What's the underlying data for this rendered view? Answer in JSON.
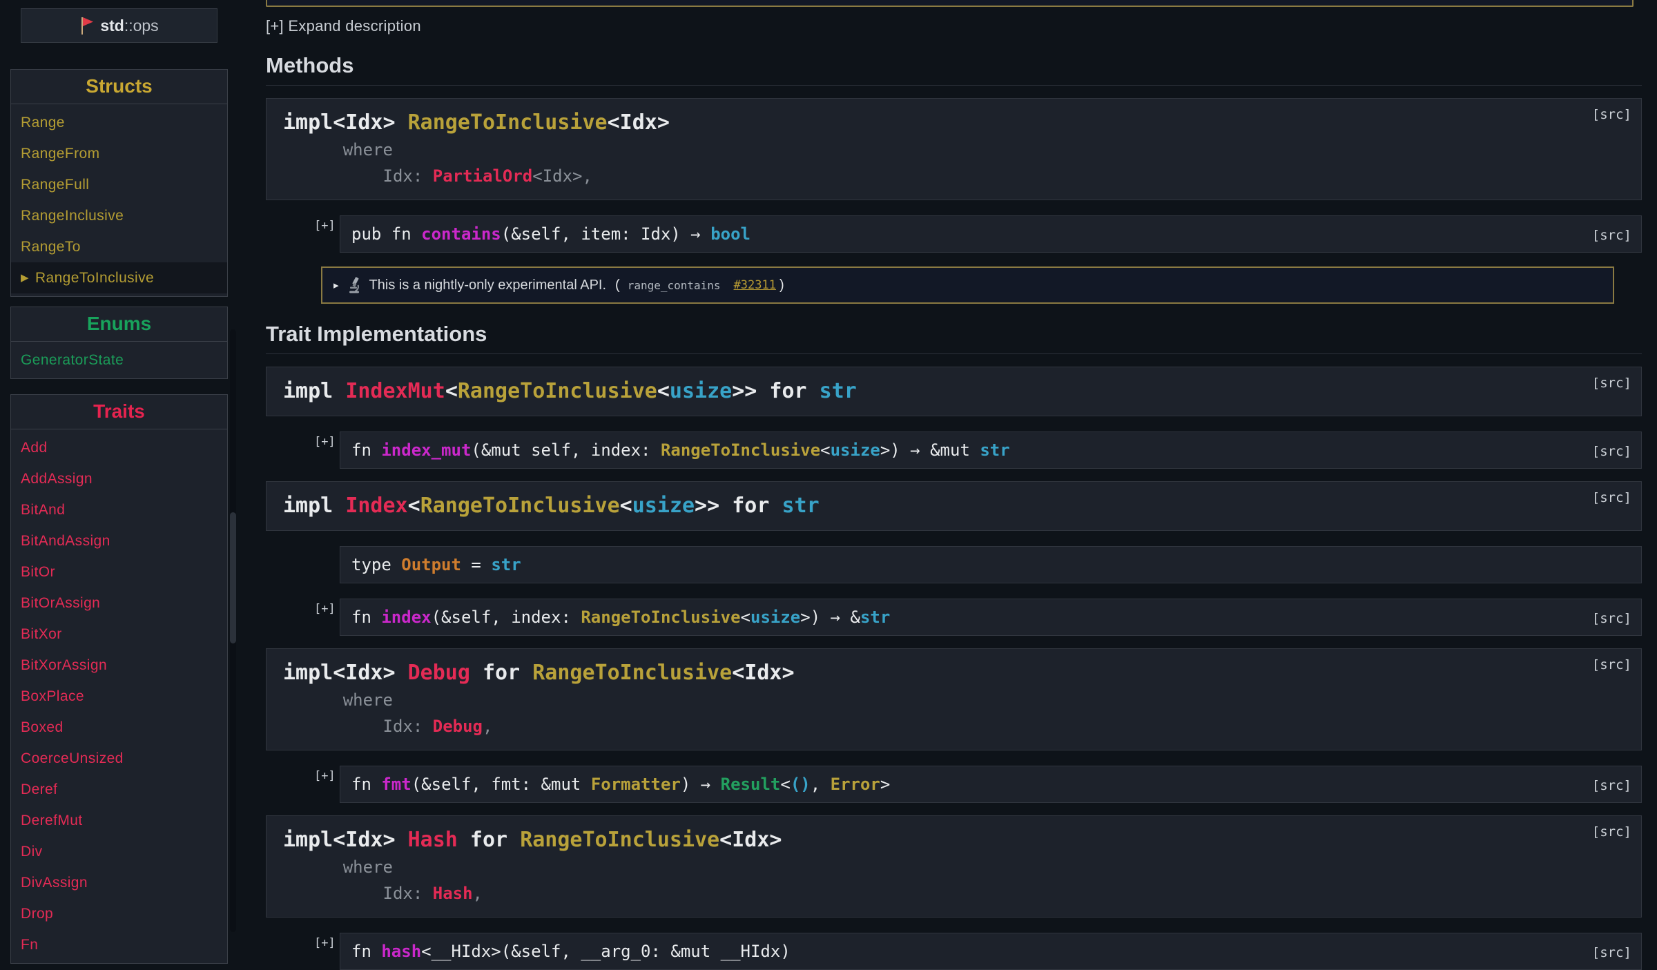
{
  "crumb": {
    "module": "std",
    "rest": "::ops"
  },
  "sidebar": {
    "sections": [
      {
        "title": "Structs",
        "kind": "struct",
        "items": [
          "Range",
          "RangeFrom",
          "RangeFull",
          "RangeInclusive",
          "RangeTo",
          "RangeToInclusive"
        ],
        "selected_index": 5
      },
      {
        "title": "Enums",
        "kind": "enum",
        "items": [
          "GeneratorState"
        ],
        "selected_index": -1
      },
      {
        "title": "Traits",
        "kind": "trait",
        "items": [
          "Add",
          "AddAssign",
          "BitAnd",
          "BitAndAssign",
          "BitOr",
          "BitOrAssign",
          "BitXor",
          "BitXorAssign",
          "BoxPlace",
          "Boxed",
          "CoerceUnsized",
          "Deref",
          "DerefMut",
          "Div",
          "DivAssign",
          "Drop",
          "Fn"
        ],
        "selected_index": -1
      }
    ]
  },
  "labels": {
    "expand": "[+] Expand description",
    "src": "[src]",
    "toggle": "[+]",
    "selected_arrow": "▶",
    "note_arrow": "▸"
  },
  "colors": {
    "gold": "#b9a23a",
    "trait_red": "#e42b55",
    "enum_green": "#18a35c",
    "fn_magenta": "#cb28cb",
    "primitive_cyan": "#38a3c8",
    "assoc_orange": "#cf7d2e",
    "result_green": "#23a05f",
    "nightly_border": "#8a7a42"
  },
  "note": {
    "icon": "microscope-icon",
    "text": "This is a nightly-only experimental API.",
    "paren_open": "(",
    "feature": "range_contains",
    "issue": "#32311",
    "paren_close": ")"
  },
  "blocks": [
    {
      "kind": "heading",
      "text": "Methods"
    },
    {
      "kind": "impl",
      "src": "[src]",
      "lines": [
        {
          "size": "lg",
          "toks": [
            {
              "t": "impl<Idx> ",
              "c": "w",
              "b": 1
            },
            {
              "t": "RangeToInclusive",
              "c": "gold",
              "b": 1
            },
            {
              "t": "<Idx>",
              "c": "w",
              "b": 1
            }
          ]
        },
        {
          "size": "sm",
          "toks": [
            {
              "t": "      where",
              "c": "g"
            }
          ]
        },
        {
          "size": "sm",
          "toks": [
            {
              "t": "          Idx: ",
              "c": "g"
            },
            {
              "t": "PartialOrd",
              "c": "red",
              "b": 1
            },
            {
              "t": "<Idx>,",
              "c": "g"
            }
          ]
        }
      ]
    },
    {
      "kind": "fn",
      "plus": true,
      "src": "[src]",
      "toks": [
        {
          "t": "pub fn ",
          "c": "w"
        },
        {
          "t": "contains",
          "c": "mag",
          "b": 1
        },
        {
          "t": "(&self, item: Idx) → ",
          "c": "w"
        },
        {
          "t": "bool",
          "c": "cyan",
          "b": 1
        }
      ]
    },
    {
      "kind": "note"
    },
    {
      "kind": "heading",
      "text": "Trait Implementations"
    },
    {
      "kind": "impl",
      "src": "[src]",
      "lines": [
        {
          "size": "lg",
          "toks": [
            {
              "t": "impl ",
              "c": "w",
              "b": 1
            },
            {
              "t": "IndexMut",
              "c": "red",
              "b": 1
            },
            {
              "t": "<",
              "c": "w",
              "b": 1
            },
            {
              "t": "RangeToInclusive",
              "c": "gold",
              "b": 1
            },
            {
              "t": "<",
              "c": "w",
              "b": 1
            },
            {
              "t": "usize",
              "c": "cyan",
              "b": 1
            },
            {
              "t": ">> ",
              "c": "w",
              "b": 1
            },
            {
              "t": "for ",
              "c": "w",
              "b": 1
            },
            {
              "t": "str",
              "c": "cyan",
              "b": 1
            }
          ]
        }
      ]
    },
    {
      "kind": "fn",
      "plus": true,
      "src": "[src]",
      "toks": [
        {
          "t": "fn ",
          "c": "w"
        },
        {
          "t": "index_mut",
          "c": "mag",
          "b": 1
        },
        {
          "t": "(&mut self, index: ",
          "c": "w"
        },
        {
          "t": "RangeToInclusive",
          "c": "gold",
          "b": 1
        },
        {
          "t": "<",
          "c": "w"
        },
        {
          "t": "usize",
          "c": "cyan",
          "b": 1
        },
        {
          "t": ">) → &mut ",
          "c": "w"
        },
        {
          "t": "str",
          "c": "cyan",
          "b": 1
        }
      ]
    },
    {
      "kind": "impl",
      "src": "[src]",
      "lines": [
        {
          "size": "lg",
          "toks": [
            {
              "t": "impl ",
              "c": "w",
              "b": 1
            },
            {
              "t": "Index",
              "c": "red",
              "b": 1
            },
            {
              "t": "<",
              "c": "w",
              "b": 1
            },
            {
              "t": "RangeToInclusive",
              "c": "gold",
              "b": 1
            },
            {
              "t": "<",
              "c": "w",
              "b": 1
            },
            {
              "t": "usize",
              "c": "cyan",
              "b": 1
            },
            {
              "t": ">> ",
              "c": "w",
              "b": 1
            },
            {
              "t": "for ",
              "c": "w",
              "b": 1
            },
            {
              "t": "str",
              "c": "cyan",
              "b": 1
            }
          ]
        }
      ]
    },
    {
      "kind": "type",
      "toks": [
        {
          "t": "type ",
          "c": "w"
        },
        {
          "t": "Output",
          "c": "orange",
          "b": 1
        },
        {
          "t": " = ",
          "c": "w"
        },
        {
          "t": "str",
          "c": "cyan",
          "b": 1
        }
      ]
    },
    {
      "kind": "fn",
      "plus": true,
      "src": "[src]",
      "toks": [
        {
          "t": "fn ",
          "c": "w"
        },
        {
          "t": "index",
          "c": "mag",
          "b": 1
        },
        {
          "t": "(&self, index: ",
          "c": "w"
        },
        {
          "t": "RangeToInclusive",
          "c": "gold",
          "b": 1
        },
        {
          "t": "<",
          "c": "w"
        },
        {
          "t": "usize",
          "c": "cyan",
          "b": 1
        },
        {
          "t": ">) → &",
          "c": "w"
        },
        {
          "t": "str",
          "c": "cyan",
          "b": 1
        }
      ]
    },
    {
      "kind": "impl",
      "src": "[src]",
      "lines": [
        {
          "size": "lg",
          "toks": [
            {
              "t": "impl<Idx> ",
              "c": "w",
              "b": 1
            },
            {
              "t": "Debug",
              "c": "red",
              "b": 1
            },
            {
              "t": " for ",
              "c": "w",
              "b": 1
            },
            {
              "t": "RangeToInclusive",
              "c": "gold",
              "b": 1
            },
            {
              "t": "<Idx>",
              "c": "w",
              "b": 1
            }
          ]
        },
        {
          "size": "sm",
          "toks": [
            {
              "t": "      where",
              "c": "g"
            }
          ]
        },
        {
          "size": "sm",
          "toks": [
            {
              "t": "          Idx: ",
              "c": "g"
            },
            {
              "t": "Debug",
              "c": "red",
              "b": 1
            },
            {
              "t": ",",
              "c": "g"
            }
          ]
        }
      ]
    },
    {
      "kind": "fn",
      "plus": true,
      "src": "[src]",
      "toks": [
        {
          "t": "fn ",
          "c": "w"
        },
        {
          "t": "fmt",
          "c": "mag",
          "b": 1
        },
        {
          "t": "(&self, fmt: &mut ",
          "c": "w"
        },
        {
          "t": "Formatter",
          "c": "gold",
          "b": 1
        },
        {
          "t": ") → ",
          "c": "w"
        },
        {
          "t": "Result",
          "c": "green",
          "b": 1
        },
        {
          "t": "<",
          "c": "w"
        },
        {
          "t": "()",
          "c": "cyan",
          "b": 1
        },
        {
          "t": ", ",
          "c": "w"
        },
        {
          "t": "Error",
          "c": "gold",
          "b": 1
        },
        {
          "t": ">",
          "c": "w"
        }
      ]
    },
    {
      "kind": "impl",
      "src": "[src]",
      "lines": [
        {
          "size": "lg",
          "toks": [
            {
              "t": "impl<Idx> ",
              "c": "w",
              "b": 1
            },
            {
              "t": "Hash",
              "c": "red",
              "b": 1
            },
            {
              "t": " for ",
              "c": "w",
              "b": 1
            },
            {
              "t": "RangeToInclusive",
              "c": "gold",
              "b": 1
            },
            {
              "t": "<Idx>",
              "c": "w",
              "b": 1
            }
          ]
        },
        {
          "size": "sm",
          "toks": [
            {
              "t": "      where",
              "c": "g"
            }
          ]
        },
        {
          "size": "sm",
          "toks": [
            {
              "t": "          Idx: ",
              "c": "g"
            },
            {
              "t": "Hash",
              "c": "red",
              "b": 1
            },
            {
              "t": ",",
              "c": "g"
            }
          ]
        }
      ]
    },
    {
      "kind": "fn",
      "plus": true,
      "src": "[src]",
      "toks": [
        {
          "t": "fn ",
          "c": "w"
        },
        {
          "t": "hash",
          "c": "mag",
          "b": 1
        },
        {
          "t": "<__HIdx>(&self, __arg_0: &mut __HIdx)",
          "c": "w"
        }
      ]
    }
  ]
}
